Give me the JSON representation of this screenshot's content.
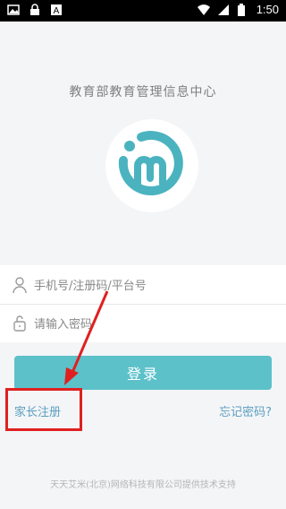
{
  "status_bar": {
    "time": "1:50",
    "left_icons": [
      "image-icon",
      "lock-icon",
      "app-a-icon"
    ],
    "right_icons": [
      "wifi-icon",
      "signal-icon",
      "battery-icon"
    ]
  },
  "header": {
    "title": "教育部教育管理信息中心"
  },
  "form": {
    "account": {
      "placeholder": "手机号/注册码/平台号",
      "value": ""
    },
    "password": {
      "placeholder": "请输入密码",
      "value": ""
    }
  },
  "actions": {
    "login_label": "登录",
    "register_label": "家长注册",
    "forgot_label": "忘记密码?"
  },
  "footer": {
    "text": "天天艾米(北京)网络科技有限公司提供技术支持"
  },
  "colors": {
    "accent": "#5cc1c9",
    "link": "#5a9fc1",
    "annotation": "#e02020"
  }
}
